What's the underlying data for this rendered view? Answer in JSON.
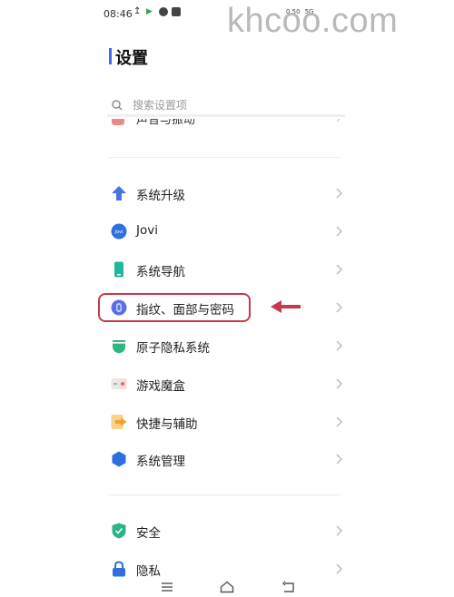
{
  "status": {
    "time": "08:46",
    "right_texts": [
      "0.50",
      "5G"
    ]
  },
  "watermark": "khcoo.com",
  "page": {
    "title": "设置"
  },
  "search": {
    "placeholder": "搜索设置项"
  },
  "cut_item": {
    "label": "声音与振动",
    "icon": "sound-icon"
  },
  "items": [
    {
      "label": "系统升级",
      "icon": "upgrade-arrow-icon",
      "color": "#4a72e8"
    },
    {
      "label": "Jovi",
      "icon": "jovi-icon",
      "color": "#2f6fe0",
      "badge": "Jovi"
    },
    {
      "label": "系统导航",
      "icon": "phone-navigation-icon",
      "color": "#1fb89a"
    },
    {
      "label": "指纹、面部与密码",
      "icon": "fingerprint-icon",
      "color": "#5a6ee8"
    },
    {
      "label": "原子隐私系统",
      "icon": "privacy-shield-icon",
      "color": "#2fb57f"
    },
    {
      "label": "游戏魔盒",
      "icon": "game-box-icon",
      "color": "#e06a6a"
    },
    {
      "label": "快捷与辅助",
      "icon": "shortcut-icon",
      "color": "#f5a32a"
    },
    {
      "label": "系统管理",
      "icon": "system-management-icon",
      "color": "#2d6fe0"
    }
  ],
  "items2": [
    {
      "label": "安全",
      "icon": "security-shield-icon",
      "color": "#2bb58b"
    },
    {
      "label": "隐私",
      "icon": "lock-icon",
      "color": "#2f6fe0"
    }
  ],
  "annotation": {
    "highlight_color": "#c6394a"
  },
  "nav": {
    "icons": [
      "menu-icon",
      "home-icon",
      "back-icon"
    ]
  }
}
